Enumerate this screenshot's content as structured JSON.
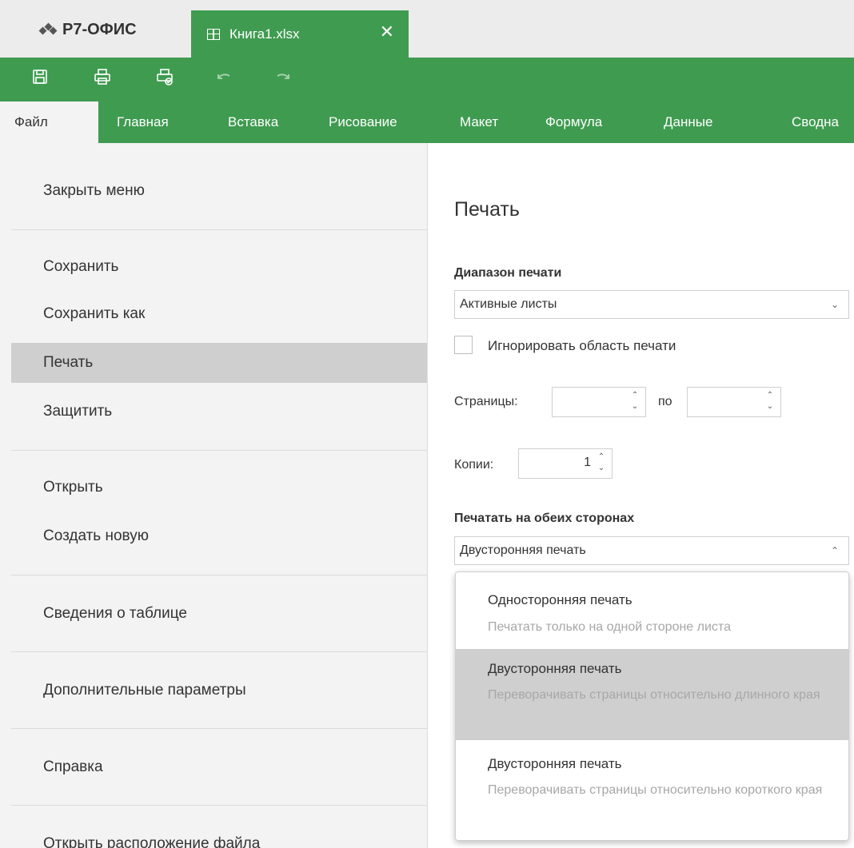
{
  "app": {
    "logo": "Р7-ОФИС",
    "tab_title": "Книга1.xlsx",
    "close_glyph": "✕"
  },
  "toolbar": {
    "icons": [
      "save-icon",
      "print-icon",
      "quick-print-icon",
      "undo-icon",
      "redo-icon"
    ]
  },
  "menu_tabs": [
    "Файл",
    "Главная",
    "Вставка",
    "Рисование",
    "Макет",
    "Формула",
    "Данные",
    "Сводна"
  ],
  "left_menu": {
    "close_menu": "Закрыть меню",
    "save": "Сохранить",
    "save_as": "Сохранить как",
    "print": "Печать",
    "protect": "Защитить",
    "open": "Открыть",
    "create_new": "Создать новую",
    "info": "Сведения о таблице",
    "advanced": "Дополнительные параметры",
    "help": "Справка",
    "open_location": "Открыть расположение файла"
  },
  "print_panel": {
    "title": "Печать",
    "range_label": "Диапазон печати",
    "range_value": "Активные листы",
    "ignore_area": "Игнорировать область печати",
    "pages_label": "Страницы:",
    "pages_to": "по",
    "copies_label": "Копии:",
    "copies_value": "1",
    "duplex_label": "Печатать на обеих сторонах",
    "duplex_value": "Двусторонняя печать",
    "options": [
      {
        "title": "Односторонняя печать",
        "desc": "Печатать только на одной стороне листа"
      },
      {
        "title": "Двусторонняя печать",
        "desc": "Переворачивать страницы относительно длинного края"
      },
      {
        "title": "Двусторонняя печать",
        "desc": "Переворачивать страницы относительно короткого края"
      }
    ]
  },
  "colors": {
    "accent": "#3f9b50",
    "menu_bg": "#f3f3f3",
    "selected_bg": "#cfcfcf"
  }
}
